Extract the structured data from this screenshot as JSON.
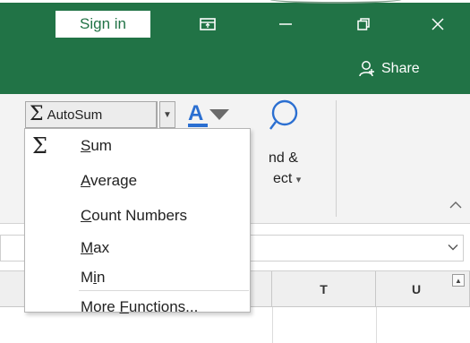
{
  "titlebar": {
    "signin_label": "Sign in",
    "share_label": "Share",
    "buttons": [
      "ribbon-display-icon",
      "minimize-icon",
      "restore-icon",
      "close-icon"
    ]
  },
  "ribbon": {
    "autosum_label": "AutoSum",
    "find_select_line1": "nd &",
    "find_select_line2": "ect",
    "find_select_arrow": "▾"
  },
  "menu": {
    "items": [
      {
        "pre": "",
        "ul": "S",
        "post": "um",
        "icon": "sigma-icon"
      },
      {
        "pre": "",
        "ul": "A",
        "post": "verage"
      },
      {
        "pre": "",
        "ul": "C",
        "post": "ount Numbers"
      },
      {
        "pre": "",
        "ul": "M",
        "post": "ax"
      },
      {
        "pre": "M",
        "ul": "i",
        "post": "n"
      },
      {
        "pre": "More ",
        "ul": "F",
        "post": "unctions..."
      }
    ]
  },
  "sheet": {
    "columns": [
      "T",
      "U"
    ]
  },
  "colors": {
    "titlebar": "#217346",
    "ribbon": "#f3f3f3",
    "accent_blue": "#2b6fd1"
  }
}
